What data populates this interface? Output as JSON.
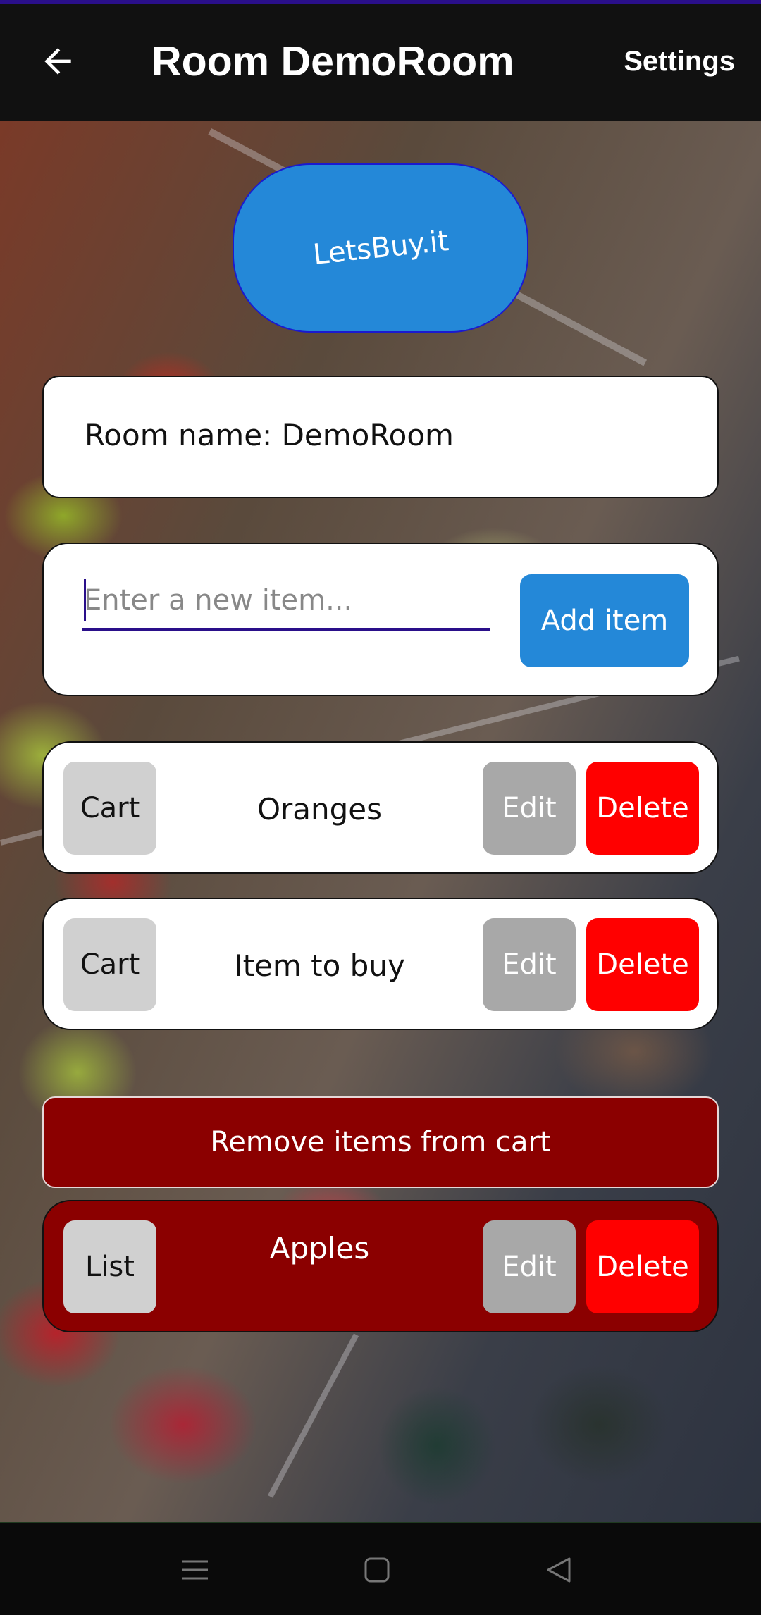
{
  "app_bar": {
    "title": "Room DemoRoom",
    "settings_label": "Settings",
    "back_icon": "arrow-left-icon"
  },
  "logo": {
    "text": "LetsBuy.it"
  },
  "room": {
    "name_text": "Room name: DemoRoom"
  },
  "add_item": {
    "placeholder": "Enter a new item...",
    "value": "",
    "button_label": "Add item"
  },
  "list_items": [
    {
      "toggle_label": "Cart",
      "name": "Oranges",
      "edit_label": "Edit",
      "delete_label": "Delete"
    },
    {
      "toggle_label": "Cart",
      "name": "Item to buy",
      "edit_label": "Edit",
      "delete_label": "Delete"
    }
  ],
  "remove_from_cart_label": "Remove items from cart",
  "cart_items": [
    {
      "toggle_label": "List",
      "name": "Apples",
      "edit_label": "Edit",
      "delete_label": "Delete"
    }
  ],
  "nav": {
    "recent_icon": "menu-lines-icon",
    "home_icon": "home-square-icon",
    "back_icon": "back-triangle-icon"
  },
  "colors": {
    "accent": "#2488d8",
    "delete": "#ff0000",
    "cart_bg": "#8b0000",
    "edit": "#a8a8a8",
    "toggle": "#d0d0d0",
    "underline": "#2a0f8a"
  }
}
